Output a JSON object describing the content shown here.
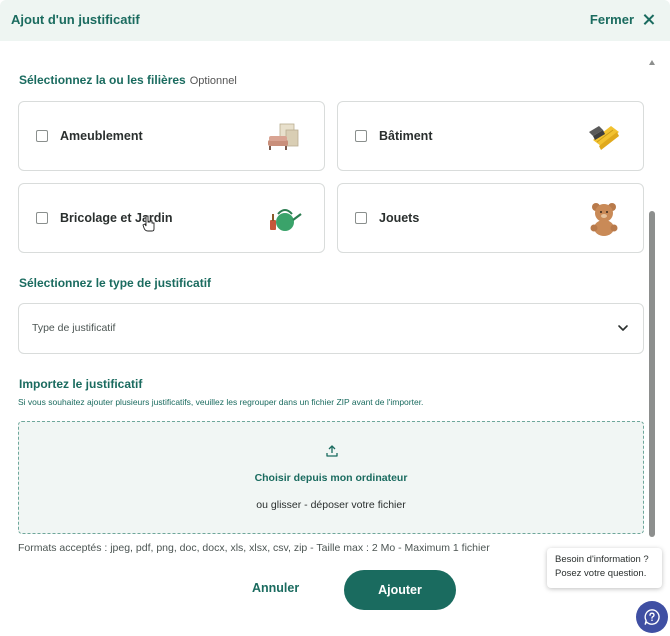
{
  "header": {
    "title": "Ajout d'un justificatif",
    "close_label": "Fermer"
  },
  "filieres": {
    "title": "Sélectionnez la ou les filières",
    "optional_label": "Optionnel",
    "items": [
      {
        "label": "Ameublement",
        "checked": false,
        "icon": "furniture-icon"
      },
      {
        "label": "Bâtiment",
        "checked": false,
        "icon": "building-materials-icon"
      },
      {
        "label": "Bricolage et Jardin",
        "checked": false,
        "icon": "watering-can-icon"
      },
      {
        "label": "Jouets",
        "checked": false,
        "icon": "teddy-bear-icon"
      }
    ]
  },
  "type": {
    "title": "Sélectionnez le type de justificatif",
    "placeholder": "Type de justificatif"
  },
  "import": {
    "title": "Importez le justificatif",
    "hint": "Si vous souhaitez ajouter plusieurs justificatifs, veuillez les regrouper dans un fichier ZIP avant de l'importer.",
    "choose_label": "Choisir depuis mon ordinateur",
    "drop_label": "ou glisser - déposer votre fichier",
    "formats": "Formats acceptés : jpeg, pdf, png, doc, docx, xls, xlsx, csv, zip - Taille max : 2 Mo - Maximum 1 fichier"
  },
  "actions": {
    "cancel_label": "Annuler",
    "add_label": "Ajouter"
  },
  "help": {
    "line1": "Besoin d'information ?",
    "line2": "Posez votre question."
  },
  "colors": {
    "primary": "#1a6b5f",
    "header_bg": "#eef5f2",
    "help_button": "#3f4fa3"
  }
}
